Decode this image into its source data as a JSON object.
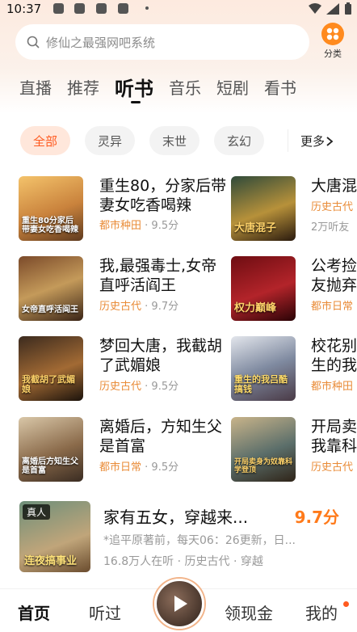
{
  "status": {
    "time": "10:37"
  },
  "search": {
    "placeholder": "修仙之最强网吧系统"
  },
  "category_button": {
    "label": "分类"
  },
  "tabs": [
    {
      "label": "直播",
      "active": false
    },
    {
      "label": "推荐",
      "active": false
    },
    {
      "label": "听书",
      "active": true
    },
    {
      "label": "音乐",
      "active": false
    },
    {
      "label": "短剧",
      "active": false
    },
    {
      "label": "看书",
      "active": false
    }
  ],
  "chips": [
    {
      "label": "全部",
      "active": true
    },
    {
      "label": "灵异",
      "active": false
    },
    {
      "label": "末世",
      "active": false
    },
    {
      "label": "玄幻",
      "active": false
    }
  ],
  "more": {
    "label": "更多"
  },
  "books_left": [
    {
      "title": "重生80，分家后带妻女吃香喝辣",
      "category": "都市种田",
      "score": "· 9.5分",
      "cover_text": "重生80分家后带妻女吃香喝辣"
    },
    {
      "title": "我,最强毒士,女帝直呼活阎王",
      "category": "历史古代",
      "score": "· 9.7分",
      "cover_text": "女帝直呼活阎王"
    },
    {
      "title": "梦回大唐，我截胡了武媚娘",
      "category": "历史古代",
      "score": "· 9.5分",
      "cover_text": "我截胡了武媚娘"
    },
    {
      "title": "离婚后，方知生父是首富",
      "category": "都市日常",
      "score": "· 9.5分",
      "cover_text": "离婚后方知生父是首富"
    }
  ],
  "books_right": [
    {
      "title": "大唐混",
      "category": "历史古代",
      "extra": "2万听友",
      "cover_text": "大唐混子"
    },
    {
      "title": "公考捡友抛弃",
      "category": "都市日常",
      "extra": "",
      "cover_text": "权力巅峰"
    },
    {
      "title": "校花别生的我",
      "category": "都市种田",
      "extra": "",
      "cover_text": "重生的我吕酷搞钱"
    },
    {
      "title": "开局卖我靠科",
      "category": "历史古代",
      "extra": "",
      "cover_text": "开局卖身为奴靠科学登顶"
    }
  ],
  "featured": {
    "badge": "真人",
    "title": "家有五女，穿越来...",
    "score": "9.7分",
    "description": "*追平原著前，每天06：26更新，日...",
    "listeners": "16.8万人在听",
    "category": "历史古代",
    "tag": "穿越",
    "cover_text": "连夜搞事业"
  },
  "bottom_nav": [
    {
      "label": "首页",
      "active": true
    },
    {
      "label": "听过",
      "active": false
    },
    {
      "label": "领现金",
      "active": false
    },
    {
      "label": "我的",
      "active": false
    }
  ],
  "colors": {
    "accent": "#ff5a1f",
    "score": "#ff7a1a",
    "category": "#e98b37"
  }
}
